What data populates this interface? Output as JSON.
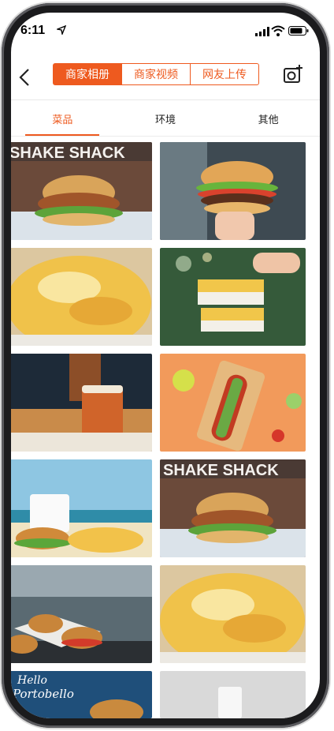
{
  "status": {
    "time": "6:11"
  },
  "nav": {
    "tabs": [
      {
        "label": "商家相册",
        "active": true
      },
      {
        "label": "商家视频",
        "active": false
      },
      {
        "label": "网友上传",
        "active": false
      }
    ]
  },
  "categories": [
    {
      "label": "菜品",
      "active": true
    },
    {
      "label": "环境",
      "active": false
    },
    {
      "label": "其他",
      "active": false
    }
  ],
  "photos": {
    "brand_text": "SHAKE SHACK",
    "hello_text": "Hello",
    "portobello_text": "Portobello"
  },
  "colors": {
    "accent": "#ee5a1f"
  }
}
